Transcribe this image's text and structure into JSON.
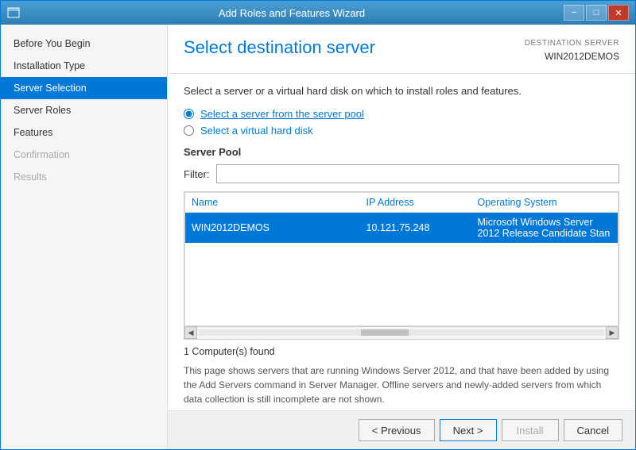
{
  "window": {
    "title": "Add Roles and Features Wizard",
    "icon": "wizard-icon"
  },
  "titlebar": {
    "minimize": "−",
    "maximize": "□",
    "close": "✕"
  },
  "sidebar": {
    "items": [
      {
        "id": "before-you-begin",
        "label": "Before You Begin",
        "state": "normal"
      },
      {
        "id": "installation-type",
        "label": "Installation Type",
        "state": "normal"
      },
      {
        "id": "server-selection",
        "label": "Server Selection",
        "state": "active"
      },
      {
        "id": "server-roles",
        "label": "Server Roles",
        "state": "normal"
      },
      {
        "id": "features",
        "label": "Features",
        "state": "normal"
      },
      {
        "id": "confirmation",
        "label": "Confirmation",
        "state": "disabled"
      },
      {
        "id": "results",
        "label": "Results",
        "state": "disabled"
      }
    ]
  },
  "header": {
    "page_title": "Select destination server",
    "destination_label": "DESTINATION SERVER",
    "destination_value": "WIN2012DEMOS"
  },
  "body": {
    "instruction": "Select a server or a virtual hard disk on which to install roles and features.",
    "radio_options": [
      {
        "id": "server-pool",
        "label": "Select a server from the server pool",
        "checked": true
      },
      {
        "id": "vhd",
        "label": "Select a virtual hard disk",
        "checked": false
      }
    ],
    "server_pool": {
      "section_title": "Server Pool",
      "filter_label": "Filter:",
      "filter_placeholder": "",
      "columns": [
        {
          "id": "name",
          "label": "Name"
        },
        {
          "id": "ip",
          "label": "IP Address"
        },
        {
          "id": "os",
          "label": "Operating System"
        }
      ],
      "rows": [
        {
          "name": "WIN2012DEMOS",
          "ip": "10.121.75.248",
          "os": "Microsoft Windows Server 2012 Release Candidate Stan",
          "selected": true
        }
      ]
    },
    "found_text": "1 Computer(s) found",
    "description": "This page shows servers that are running Windows Server 2012, and that have been added by using the Add Servers command in Server Manager. Offline servers and newly-added servers from which data collection is still incomplete are not shown."
  },
  "footer": {
    "previous_label": "< Previous",
    "next_label": "Next >",
    "install_label": "Install",
    "cancel_label": "Cancel"
  }
}
